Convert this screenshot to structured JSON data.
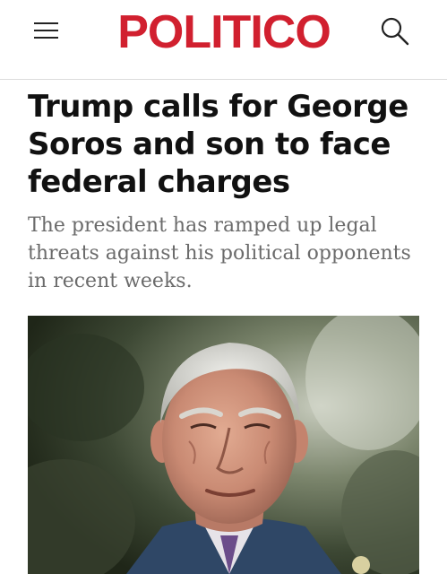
{
  "header": {
    "logo_text": "POLITICO",
    "menu_icon": "hamburger-menu-icon",
    "search_icon": "search-icon",
    "brand_color": "#d1202f"
  },
  "article": {
    "headline": "Trump calls for George Soros and son to face federal charges",
    "dek": "The president has ramped up legal threats against his political opponents in recent weeks."
  },
  "hero_image": {
    "subject": "portrait photo of an elderly man in a suit"
  }
}
